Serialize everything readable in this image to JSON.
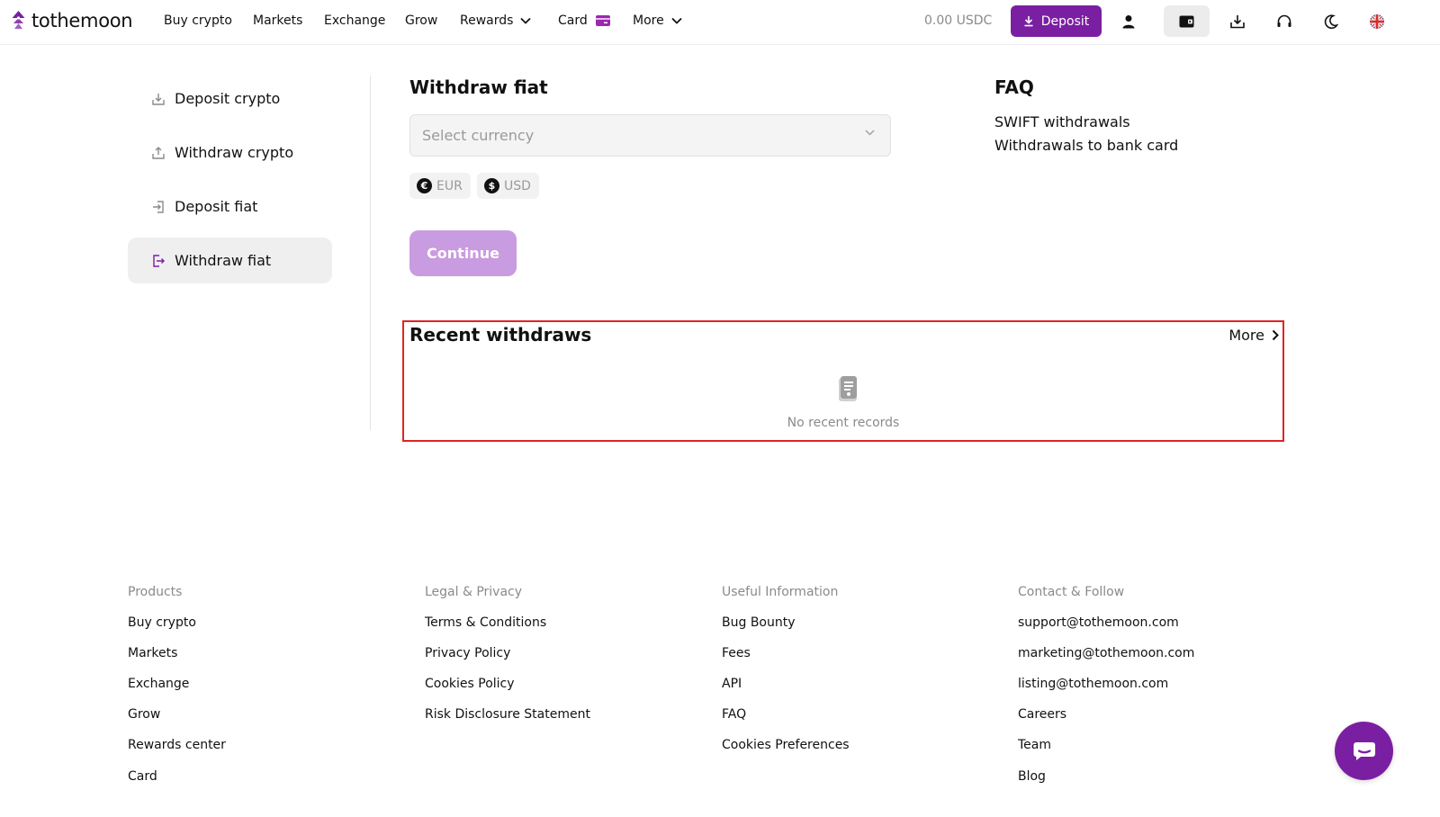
{
  "colors": {
    "brand": "#7b1fa2",
    "brand_light": "#c99be0",
    "highlight_border": "#e02424"
  },
  "header": {
    "logo_text": "tothemoon",
    "nav": [
      {
        "label": "Buy crypto"
      },
      {
        "label": "Markets"
      },
      {
        "label": "Exchange"
      },
      {
        "label": "Grow"
      },
      {
        "label": "Rewards",
        "icon": "chevron-down-icon"
      },
      {
        "label": "Card",
        "icon": "card-icon"
      },
      {
        "label": "More",
        "icon": "chevron-down-icon"
      }
    ],
    "balance": "0.00 USDC",
    "deposit_label": "Deposit",
    "icons": [
      "user-icon",
      "wallet-icon",
      "download-app-icon",
      "support-headset-icon",
      "dark-mode-moon-icon",
      "language-flag-icon"
    ]
  },
  "sidebar": {
    "items": [
      {
        "label": "Deposit crypto",
        "icon": "download-icon",
        "active": false
      },
      {
        "label": "Withdraw crypto",
        "icon": "upload-icon",
        "active": false
      },
      {
        "label": "Deposit fiat",
        "icon": "sign-in-icon",
        "active": false
      },
      {
        "label": "Withdraw fiat",
        "icon": "sign-out-icon",
        "active": true
      }
    ]
  },
  "main": {
    "title": "Withdraw fiat",
    "currency_select": {
      "placeholder": "Select currency"
    },
    "quick_currencies": [
      {
        "symbol": "€",
        "code": "EUR"
      },
      {
        "symbol": "$",
        "code": "USD"
      }
    ],
    "continue_label": "Continue",
    "recent": {
      "title": "Recent withdraws",
      "more_label": "More",
      "empty_text": "No recent records"
    }
  },
  "faq": {
    "title": "FAQ",
    "links": [
      "SWIFT withdrawals",
      "Withdrawals to bank card"
    ]
  },
  "footer": {
    "columns": [
      {
        "heading": "Products",
        "links": [
          "Buy crypto",
          "Markets",
          "Exchange",
          "Grow",
          "Rewards center",
          "Card"
        ]
      },
      {
        "heading": "Legal & Privacy",
        "links": [
          "Terms & Conditions",
          "Privacy Policy",
          "Cookies Policy",
          "Risk Disclosure Statement"
        ]
      },
      {
        "heading": "Useful Information",
        "links": [
          "Bug Bounty",
          "Fees",
          "API",
          "FAQ",
          "Cookies Preferences"
        ]
      },
      {
        "heading": "Contact & Follow",
        "links": [
          "support@tothemoon.com",
          "marketing@tothemoon.com",
          "listing@tothemoon.com",
          "Careers",
          "Team",
          "Blog"
        ]
      }
    ]
  },
  "chat": {
    "icon": "chat-icon"
  }
}
